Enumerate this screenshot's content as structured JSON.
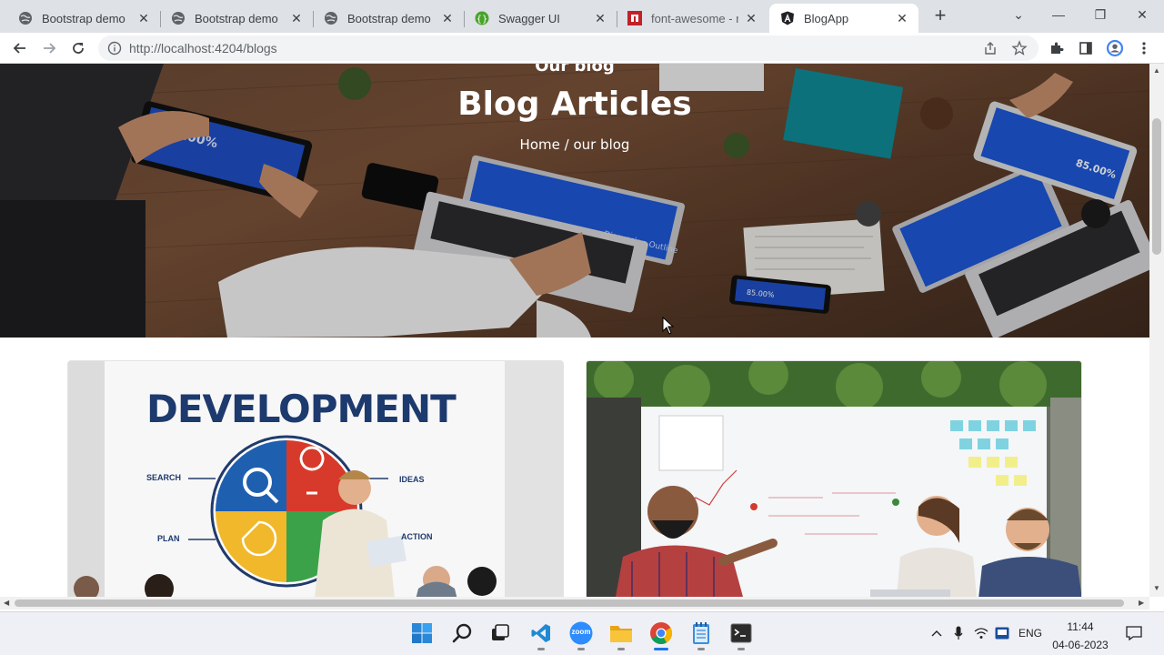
{
  "browser": {
    "tabs": [
      {
        "title": "Bootstrap demo",
        "favicon": "globe-icon",
        "active": false
      },
      {
        "title": "Bootstrap demo",
        "favicon": "globe-icon",
        "active": false
      },
      {
        "title": "Bootstrap demo",
        "favicon": "globe-icon",
        "active": false
      },
      {
        "title": "Swagger UI",
        "favicon": "swagger-icon",
        "active": false
      },
      {
        "title": "font-awesome - npm",
        "favicon": "npm-icon",
        "active": false
      },
      {
        "title": "BlogApp",
        "favicon": "angular-icon",
        "active": true
      }
    ],
    "url": "http://localhost:4204/blogs",
    "colors": {
      "tabstrip": "#dee1e6",
      "active_tab": "#ffffff",
      "omnibox": "#f1f3f4"
    }
  },
  "page": {
    "hero": {
      "kicker": "Our blog",
      "title": "Blog Articles",
      "breadcrumb_home": "Home",
      "breadcrumb_separator": " / ",
      "breadcrumb_current": "our blog"
    },
    "cards": [
      {
        "image": "development-poster-photo",
        "poster_heading": "DEVELOPMENT",
        "poster_labels": {
          "search": "SEARCH",
          "ideas": "IDEAS",
          "plan": "PLAN",
          "action": "ACTION"
        }
      },
      {
        "image": "whiteboard-meeting-photo"
      }
    ]
  },
  "taskbar": {
    "apps": [
      "windows-start-icon",
      "search-icon",
      "task-view-icon",
      "vscode-icon",
      "zoom-icon",
      "file-explorer-icon",
      "chrome-icon",
      "notepad-icon",
      "terminal-icon"
    ],
    "zoom_label": "zoom",
    "language": "ENG",
    "time": "11:44",
    "date": "04-06-2023"
  }
}
